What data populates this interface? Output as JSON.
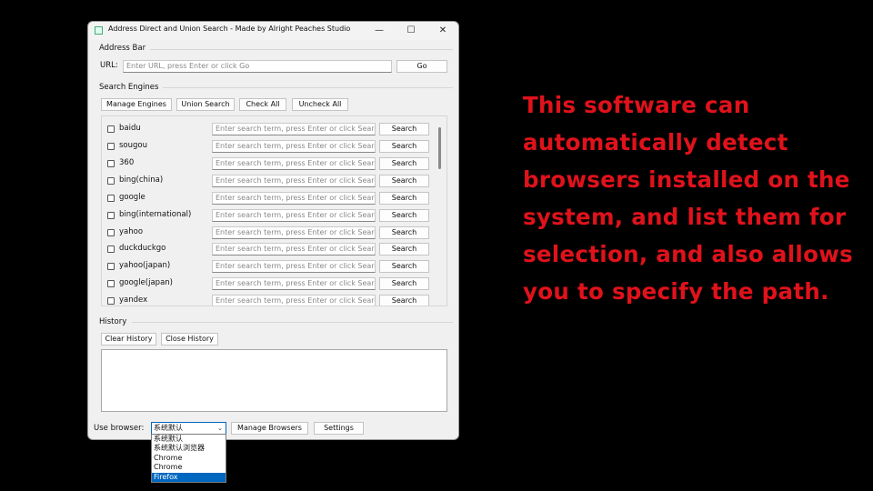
{
  "window": {
    "title": "Address Direct and Union Search - Made by Alright Peaches Studio",
    "controls": {
      "minimize": "—",
      "maximize": "☐",
      "close": "✕"
    }
  },
  "address_bar": {
    "section_label": "Address Bar",
    "url_label": "URL:",
    "url_placeholder": "Enter URL, press Enter or click Go",
    "go_label": "Go"
  },
  "search_engines": {
    "section_label": "Search Engines",
    "toolbar": {
      "manage": "Manage Engines",
      "union": "Union Search",
      "check_all": "Check All",
      "uncheck_all": "Uncheck All"
    },
    "input_placeholder": "Enter search term, press Enter or click Search",
    "search_label": "Search",
    "engines": [
      "baidu",
      "sougou",
      "360",
      "bing(china)",
      "google",
      "bing(international)",
      "yahoo",
      "duckduckgo",
      "yahoo(japan)",
      "google(japan)",
      "yandex"
    ]
  },
  "history": {
    "section_label": "History",
    "clear": "Clear History",
    "close": "Close History"
  },
  "browser": {
    "label": "Use browser:",
    "selected": "系统默认",
    "options": [
      "系统默认",
      "系统默认浏览器",
      "Chrome",
      "Chrome",
      "Firefox"
    ],
    "highlighted_index": 4,
    "manage": "Manage Browsers",
    "settings": "Settings"
  },
  "caption": "This software can automatically detect browsers installed on the system, and list them for selection, and also allows you to specify the path.",
  "colors": {
    "caption": "#e0121b",
    "selection": "#0067c0"
  }
}
